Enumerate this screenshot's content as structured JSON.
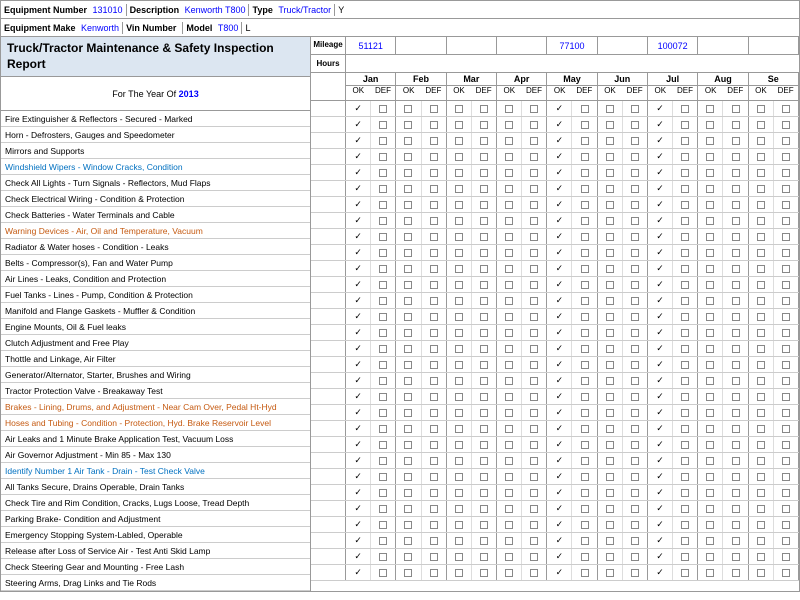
{
  "header": {
    "equipment_number_label": "Equipment Number",
    "equipment_number_value": "131010",
    "equipment_make_label": "Equipment Make",
    "equipment_make_value": "Kenworth",
    "description_label": "Description",
    "description_value": "Kenworth T800",
    "vin_number_label": "Vin Number",
    "vin_number_value": "",
    "type_label": "Type",
    "type_value": "Truck/Tractor",
    "model_label": "Model",
    "model_value": "T800"
  },
  "report": {
    "title": "Truck/Tractor Maintenance & Safety Inspection Report",
    "year_label": "For The Year Of",
    "year": "2013"
  },
  "mileage": {
    "mileage_label": "Mileage",
    "hours_label": "Hours",
    "values": [
      "51121",
      "",
      "",
      "",
      "77100",
      "",
      "100072",
      "",
      ""
    ]
  },
  "months": [
    {
      "name": "Jan",
      "ok": "OK",
      "def": "DEF"
    },
    {
      "name": "Feb",
      "ok": "OK",
      "def": "DEF"
    },
    {
      "name": "Mar",
      "ok": "OK",
      "def": "DEF"
    },
    {
      "name": "Apr",
      "ok": "OK",
      "def": "DEF"
    },
    {
      "name": "May",
      "ok": "OK",
      "def": "DEF"
    },
    {
      "name": "Jun",
      "ok": "OK",
      "def": "DEF"
    },
    {
      "name": "Jul",
      "ok": "OK",
      "def": "DEF"
    },
    {
      "name": "Aug",
      "ok": "OK",
      "def": "DEF"
    },
    {
      "name": "Se",
      "ok": "OK",
      "def": "DEF"
    }
  ],
  "inspection_items": [
    {
      "text": "Fire Extinguisher & Reflectors - Secured - Marked",
      "color": "black"
    },
    {
      "text": "Horn - Defrosters, Gauges and Speedometer",
      "color": "black"
    },
    {
      "text": "Mirrors and Supports",
      "color": "black"
    },
    {
      "text": "Windshield Wipers - Window Cracks, Condition",
      "color": "blue"
    },
    {
      "text": "Check All Lights - Turn Signals - Reflectors, Mud Flaps",
      "color": "black"
    },
    {
      "text": "Check Electrical Wiring - Condition & Protection",
      "color": "black"
    },
    {
      "text": "Check Batteries - Water Terminals and Cable",
      "color": "black"
    },
    {
      "text": "Warning Devices - Air, Oil and Temperature, Vacuum",
      "color": "orange"
    },
    {
      "text": "Radiator & Water hoses - Condition - Leaks",
      "color": "black"
    },
    {
      "text": "Belts - Compressor(s), Fan and Water Pump",
      "color": "black"
    },
    {
      "text": "Air Lines - Leaks, Condition and Protection",
      "color": "black"
    },
    {
      "text": "Fuel Tanks - Lines - Pump, Condition & Protection",
      "color": "black"
    },
    {
      "text": "Manifold and Flange Gaskets - Muffler & Condition",
      "color": "black"
    },
    {
      "text": "Engine Mounts, Oil & Fuel leaks",
      "color": "black"
    },
    {
      "text": "Clutch Adjustment and Free Play",
      "color": "black"
    },
    {
      "text": "Thottle and Linkage, Air Filter",
      "color": "black"
    },
    {
      "text": "Generator/Alternator, Starter, Brushes and Wiring",
      "color": "black"
    },
    {
      "text": "Tractor Protection Valve - Breakaway Test",
      "color": "black"
    },
    {
      "text": "Brakes - Lining, Drums, and Adjustment - Near Cam Over, Pedal Ht-Hyd",
      "color": "orange"
    },
    {
      "text": "Hoses and Tubing - Condition - Protection, Hyd. Brake Reservoir Level",
      "color": "orange"
    },
    {
      "text": "Air Leaks and 1 Minute Brake Application Test, Vacuum Loss",
      "color": "black"
    },
    {
      "text": "Air Governor Adjustment - Min 85 - Max 130",
      "color": "black"
    },
    {
      "text": "Identify Number 1 Air Tank - Drain - Test Check Valve",
      "color": "blue"
    },
    {
      "text": "All Tanks Secure, Drains Operable, Drain Tanks",
      "color": "black"
    },
    {
      "text": "Check Tire and Rim Condition, Cracks, Lugs Loose, Tread Depth",
      "color": "black"
    },
    {
      "text": "Parking Brake- Condition and Adjustment",
      "color": "black"
    },
    {
      "text": "Emergency Stopping System-Labled, Operable",
      "color": "black"
    },
    {
      "text": "Release after Loss of Service Air - Test Anti Skid Lamp",
      "color": "black"
    },
    {
      "text": "Check Steering Gear and Mounting - Free Lash",
      "color": "black"
    },
    {
      "text": "Steering Arms, Drag Links and Tie Rods",
      "color": "black"
    }
  ],
  "check_data": {
    "jan_checked": [
      true,
      true,
      true,
      true,
      true,
      true,
      true,
      true,
      true,
      true,
      true,
      true,
      true,
      true,
      true,
      true,
      true,
      true,
      true,
      true,
      true,
      true,
      true,
      true,
      true,
      true,
      true,
      true,
      true,
      true
    ],
    "may_checked": [
      true,
      true,
      true,
      true,
      true,
      true,
      true,
      true,
      true,
      true,
      true,
      true,
      true,
      true,
      true,
      true,
      true,
      true,
      true,
      true,
      true,
      true,
      true,
      true,
      true,
      true,
      true,
      true,
      true,
      true
    ],
    "jul_checked": [
      true,
      true,
      true,
      true,
      true,
      true,
      true,
      true,
      true,
      true,
      true,
      true,
      true,
      true,
      true,
      true,
      true,
      true,
      true,
      true,
      true,
      true,
      true,
      true,
      true,
      true,
      true,
      true,
      true,
      true
    ]
  }
}
